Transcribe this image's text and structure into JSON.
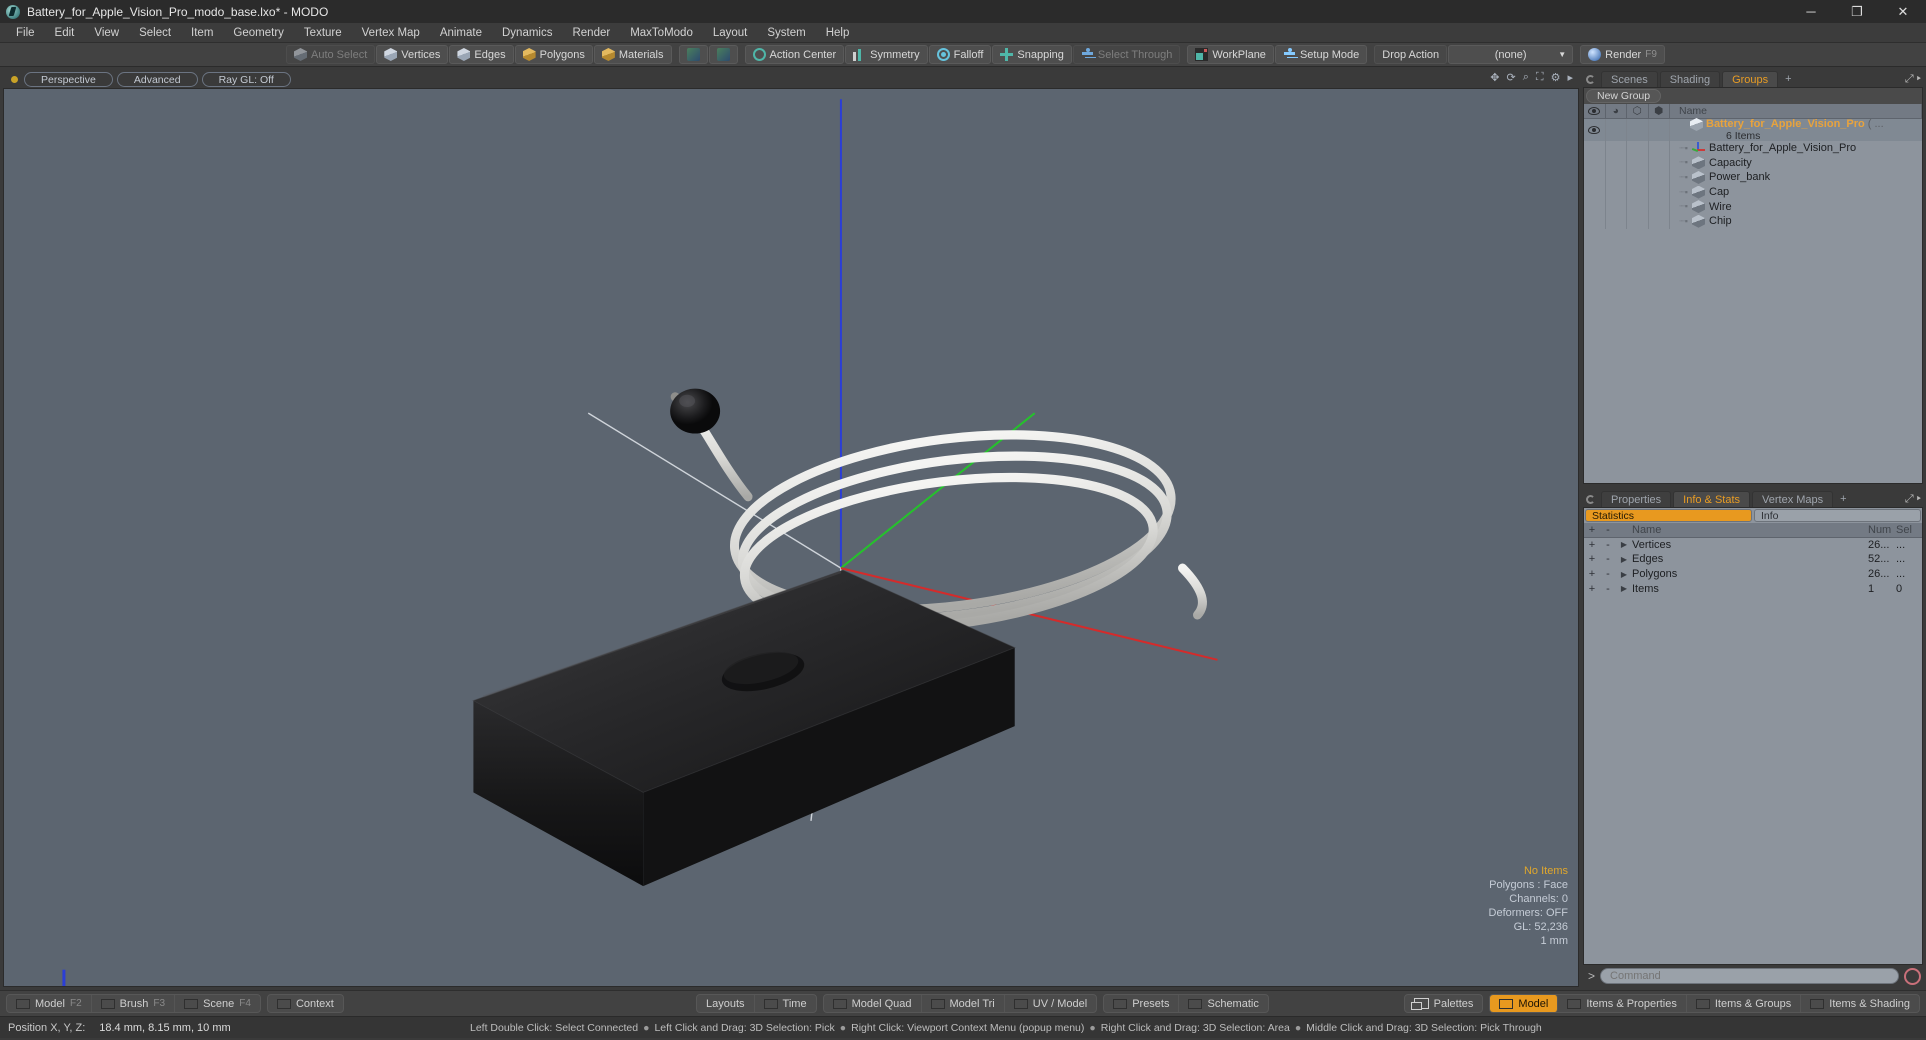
{
  "window": {
    "title": "Battery_for_Apple_Vision_Pro_modo_base.lxo* - MODO",
    "app_icon": "modo-app-icon",
    "buttons": {
      "minimize": "─",
      "maximize": "❐",
      "close": "✕"
    }
  },
  "menubar": {
    "items": [
      "File",
      "Edit",
      "View",
      "Select",
      "Item",
      "Geometry",
      "Texture",
      "Vertex Map",
      "Animate",
      "Dynamics",
      "Render",
      "MaxToModo",
      "Layout",
      "System",
      "Help"
    ]
  },
  "toolbar": {
    "items": [
      {
        "label": "Auto Select",
        "icon": "cube-grey-icon",
        "state": "disabled"
      },
      {
        "label": "Vertices",
        "icon": "cube-blue-icon",
        "state": "normal"
      },
      {
        "label": "Edges",
        "icon": "cube-blue-icon",
        "state": "normal"
      },
      {
        "label": "Polygons",
        "icon": "cube-yellow-icon",
        "state": "normal"
      },
      {
        "label": "Materials",
        "icon": "cube-yellow-icon",
        "state": "normal"
      },
      {
        "label": "",
        "icon": "select-mode-1-icon",
        "state": "normal"
      },
      {
        "label": "",
        "icon": "select-mode-2-icon",
        "state": "normal"
      },
      {
        "label": "Action Center",
        "icon": "action-center-icon",
        "state": "normal"
      },
      {
        "label": "Symmetry",
        "icon": "symmetry-icon",
        "state": "normal"
      },
      {
        "label": "Falloff",
        "icon": "falloff-icon",
        "state": "normal"
      },
      {
        "label": "Snapping",
        "icon": "snapping-icon",
        "state": "normal"
      },
      {
        "label": "Select Through",
        "icon": "select-through-icon",
        "state": "disabled"
      },
      {
        "label": "WorkPlane",
        "icon": "workplane-icon",
        "state": "normal"
      },
      {
        "label": "Setup Mode",
        "icon": "setup-mode-icon",
        "state": "normal"
      }
    ],
    "drop_action_label": "Drop Action",
    "drop_action_value": "(none)",
    "render_label": "Render",
    "render_shortcut": "F9",
    "render_icon": "render-sphere-icon"
  },
  "viewport": {
    "header": {
      "indicator": "viewport-state-dot",
      "buttons": [
        "Perspective",
        "Advanced",
        "Ray GL: Off"
      ],
      "icons": [
        "move-icon",
        "rotate-icon",
        "zoom-icon",
        "fit-icon",
        "gear-icon",
        "maximize-icon"
      ]
    },
    "stats": {
      "selection": "No Items",
      "mode": "Polygons : Face",
      "channels": "Channels: 0",
      "deformers": "Deformers: OFF",
      "gl": "GL: 52,236",
      "grid": "1 mm"
    },
    "scene_description": "Black rectangular power bank with coiled white USB-C cable and small black cap, on grey background with X/Y/Z axis lines"
  },
  "right_panel": {
    "top_tabs": {
      "items": [
        "Scenes",
        "Shading",
        "Groups"
      ],
      "active": "Groups",
      "add": "+"
    },
    "new_group_button": "New Group",
    "tree_header": {
      "columns": [
        "visibility-icon",
        "render-icon",
        "lock-icon",
        "shade-icon"
      ],
      "name": "Name"
    },
    "tree": {
      "root": {
        "label": "Battery_for_Apple_Vision_Pro",
        "suffix": "( ...",
        "count": "6 Items",
        "icon": "group-cube-icon"
      },
      "children": [
        {
          "label": "Battery_for_Apple_Vision_Pro",
          "icon": "locator-axis-icon"
        },
        {
          "label": "Capacity",
          "icon": "mesh-cube-icon"
        },
        {
          "label": "Power_bank",
          "icon": "mesh-cube-icon"
        },
        {
          "label": "Cap",
          "icon": "mesh-cube-icon"
        },
        {
          "label": "Wire",
          "icon": "mesh-cube-icon"
        },
        {
          "label": "Chip",
          "icon": "mesh-cube-icon"
        }
      ]
    },
    "bottom_tabs": {
      "items": [
        "Properties",
        "Info & Stats",
        "Vertex Maps"
      ],
      "active": "Info & Stats",
      "add": "+"
    },
    "stats_segments": {
      "left": "Statistics",
      "right": "Info",
      "active": "Statistics"
    },
    "stats_table": {
      "headers": {
        "plus": "+",
        "minus": "-",
        "name": "Name",
        "num": "Num",
        "sel": "Sel"
      },
      "rows": [
        {
          "plus": "+",
          "minus": "-",
          "name": "Vertices",
          "num": "26...",
          "sel": "..."
        },
        {
          "plus": "+",
          "minus": "-",
          "name": "Edges",
          "num": "52...",
          "sel": "..."
        },
        {
          "plus": "+",
          "minus": "-",
          "name": "Polygons",
          "num": "26...",
          "sel": "..."
        },
        {
          "plus": "+",
          "minus": "-",
          "name": "Items",
          "num": "1",
          "sel": "0"
        }
      ]
    },
    "command": {
      "prompt": ">",
      "placeholder": "Command",
      "record_icon": "record-circle-icon"
    }
  },
  "bottom_bar": {
    "left": [
      {
        "label": "Model",
        "fkey": "F2",
        "icon": "panel-swatch-green"
      },
      {
        "label": "Brush",
        "fkey": "F3",
        "icon": "panel-swatch-green"
      },
      {
        "label": "Scene",
        "fkey": "F4",
        "icon": "panel-swatch-green"
      }
    ],
    "left2": [
      {
        "label": "Context",
        "fkey": "",
        "icon": "panel-swatch-green"
      }
    ],
    "center": [
      {
        "label": "Layouts",
        "icon": ""
      },
      {
        "label": "Time",
        "icon": "panel-swatch-blue"
      }
    ],
    "center2": [
      {
        "label": "Model Quad",
        "icon": "panel-swatch-green"
      },
      {
        "label": "Model Tri",
        "icon": "panel-swatch-green"
      },
      {
        "label": "UV / Model",
        "icon": "panel-swatch-green"
      }
    ],
    "center3": [
      {
        "label": "Presets",
        "icon": "panel-swatch-blue"
      },
      {
        "label": "Schematic",
        "icon": "panel-swatch-blue"
      }
    ],
    "right": [
      {
        "label": "Palettes",
        "icon": "palettes-icon"
      }
    ],
    "right2": [
      {
        "label": "Model",
        "icon": "panel-swatch-green",
        "active": true
      },
      {
        "label": "Items & Properties",
        "icon": "panel-swatch-green",
        "active": false
      },
      {
        "label": "Items & Groups",
        "icon": "panel-swatch-green",
        "active": false
      },
      {
        "label": "Items & Shading",
        "icon": "panel-swatch-green",
        "active": false
      }
    ]
  },
  "status_bar": {
    "position_label": "Position X, Y, Z:",
    "position_value": "18.4 mm, 8.15 mm, 10 mm",
    "hints": [
      "Left Double Click: Select Connected",
      "Left Click and Drag: 3D Selection: Pick",
      "Right Click: Viewport Context Menu (popup menu)",
      "Right Click and Drag: 3D Selection: Area",
      "Middle Click and Drag: 3D Selection: Pick Through"
    ]
  },
  "colors": {
    "accent": "#e8991f",
    "panel_bg": "#8d949d",
    "viewport_bg": "#5c6570",
    "chrome": "#3a3a3a"
  }
}
